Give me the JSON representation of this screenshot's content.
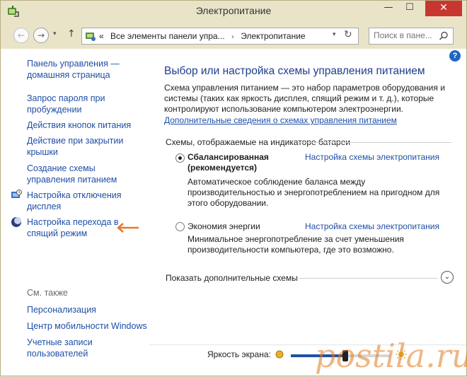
{
  "window": {
    "title": "Электропитание",
    "controls": {
      "minimize": "—",
      "maximize": "☐",
      "close": "✕"
    }
  },
  "address_bar": {
    "back": "←",
    "forward": "→",
    "history": "▾",
    "up": "↑",
    "prefix": "«",
    "crumbs": [
      "Все элементы панели упра...",
      "Электропитание"
    ],
    "crumb_sep": "›",
    "dropdown": "▾",
    "refresh": "↻",
    "search_placeholder": "Поиск в пане..."
  },
  "sidebar": {
    "home": "Панель управления — домашняя страница",
    "links": [
      "Запрос пароля при пробуждении",
      "Действия кнопок питания",
      "Действие при закрытии крышки",
      "Создание схемы управления питанием",
      "Настройка отключения дисплея",
      "Настройка перехода в спящий режим"
    ],
    "see_also": "См. также",
    "see_also_links": [
      "Персонализация",
      "Центр мобильности Windows",
      "Учетные записи пользователей"
    ]
  },
  "main": {
    "help": "?",
    "title": "Выбор или настройка схемы управления питанием",
    "description": "Схема управления питанием — это набор параметров оборудования и системы (таких как яркость дисплея, спящий режим и т. д.), которые контролируют использование компьютером электроэнергии.",
    "more_info_link": "Дополнительные сведения о схемах управления питанием",
    "group_title": "Схемы, отображаемые на индикаторе батареи",
    "plans": [
      {
        "name": "Сбалансированная (рекомендуется)",
        "link": "Настройка схемы электропитания",
        "description": "Автоматическое соблюдение баланса между производительностью и энергопотреблением на пригодном для этого оборудовании.",
        "selected": true
      },
      {
        "name": "Экономия энергии",
        "link": "Настройка схемы электропитания",
        "description": "Минимальное энергопотребление за счет уменьшения производительности компьютера, где это возможно.",
        "selected": false
      }
    ],
    "show_more": "Показать дополнительные схемы",
    "expand": "⌄"
  },
  "brightness": {
    "label": "Яркость экрана:",
    "level": 0.55
  },
  "colors": {
    "link": "#1f4fa6",
    "title": "#1e3d8c",
    "chrome": "#e9e4c8",
    "close": "#c7372f",
    "annotation_arrow": "#e8782a"
  }
}
